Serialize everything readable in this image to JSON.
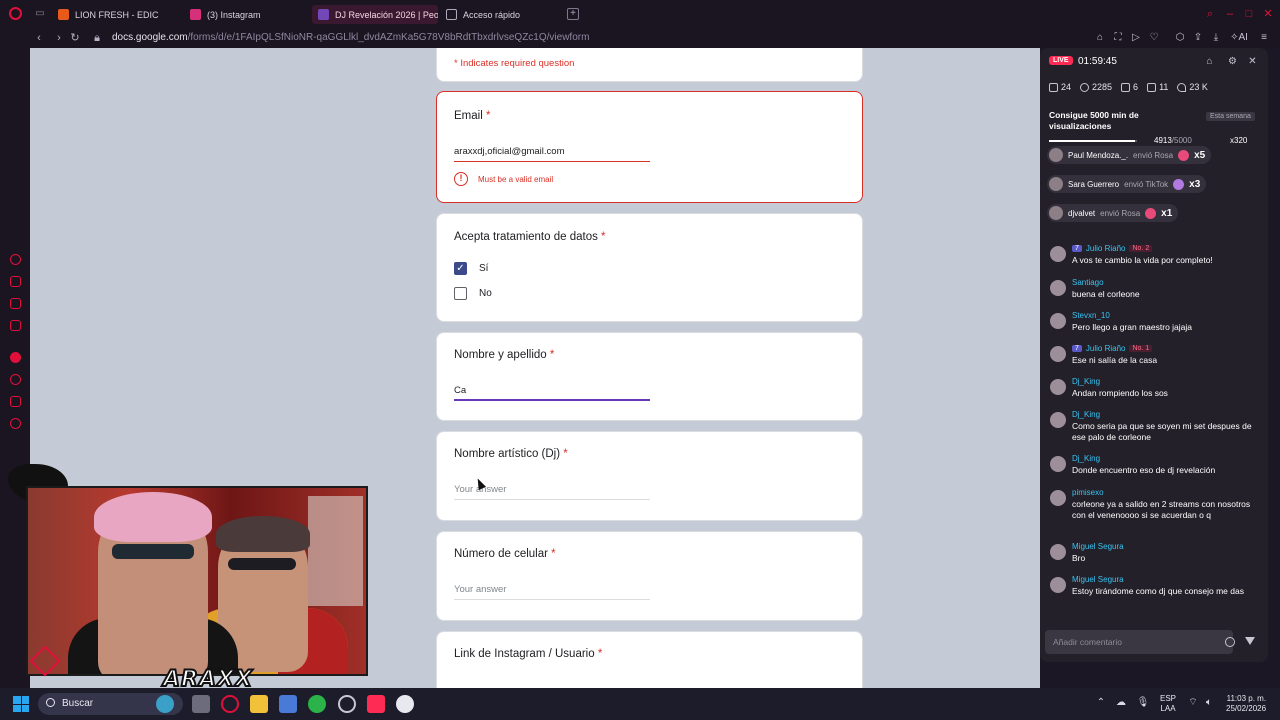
{
  "browser": {
    "tabs": [
      {
        "label": "LION FRESH - EDIC",
        "active": false
      },
      {
        "label": "(3) Instagram",
        "active": false
      },
      {
        "label": "DJ Revelación 2026 | Peo",
        "active": true
      },
      {
        "label": "Acceso rápido",
        "active": false
      }
    ],
    "url_domain": "docs.google.com",
    "url_path": "/forms/d/e/1FAIpQLSfNioNR-qaGGLlkl_dvdAZmKa5G78V8bRdtTbxdrlvseQZc1Q/viewform",
    "toolbar_ai_label": "AI"
  },
  "form": {
    "required_note": "* Indicates required question",
    "req_mark": "*",
    "email": {
      "label": "Email",
      "value": "araxxdj,oficial@gmail.com",
      "error": "Must be a valid email"
    },
    "consent": {
      "label": "Acepta tratamiento de datos",
      "options": [
        {
          "label": "Sí",
          "checked": true
        },
        {
          "label": "No",
          "checked": false
        }
      ]
    },
    "full_name": {
      "label": "Nombre y apellido",
      "value": "Ca"
    },
    "artist_name": {
      "label": "Nombre artístico (Dj)",
      "placeholder": "Your answer"
    },
    "phone": {
      "label": "Número de celular",
      "placeholder": "Your answer"
    },
    "instagram": {
      "label": "Link de Instagram / Usuario"
    }
  },
  "webcam": {
    "logo_text": "ARAXX"
  },
  "live": {
    "badge": "LIVE",
    "time": "01:59:45",
    "stats": {
      "viewers_icon_count": "24",
      "views": "2285",
      "gifts": "6",
      "shares": "11",
      "likes": "23 K"
    },
    "goal": {
      "title": "Consigue 5000 min de visualizaciones",
      "tag": "Esta semana",
      "current": "4913",
      "max": "/5000",
      "progress": 0.9826,
      "reward": "x320"
    },
    "gifts": [
      {
        "user": "Paul Mendoza._.",
        "action": "envió Rosa",
        "count": "x5",
        "color": "#e84a7a"
      },
      {
        "user": "Sara Guerrero",
        "action": "envió TikTok",
        "count": "x3",
        "color": "#b07ae0"
      },
      {
        "user": "djvalvet",
        "action": "envió Rosa",
        "count": "x1",
        "color": "#e84a7a"
      }
    ],
    "messages": [
      {
        "user": "Julio Riaño",
        "level": "7",
        "rank": "No. 2",
        "text": "A vos te cambio la vida por completo!"
      },
      {
        "user": "Santiago",
        "level": "",
        "rank": "",
        "text": "buena el corleone"
      },
      {
        "user": "Stevxn_10",
        "level": "",
        "rank": "",
        "text": "Pero llego a gran maestro jajaja"
      },
      {
        "user": "Julio Riaño",
        "level": "7",
        "rank": "No. 1",
        "text": "Ese ni salía de la casa"
      },
      {
        "user": "Dj_King",
        "level": "",
        "rank": "",
        "text": "Andan rompiendo los sos"
      },
      {
        "user": "Dj_King",
        "level": "",
        "rank": "",
        "text": "Como seria pa que se soyen mi set despues de ese palo de corleone"
      },
      {
        "user": "Dj_King",
        "level": "",
        "rank": "",
        "text": "Donde encuentro eso de dj revelación"
      },
      {
        "user": "pimisexo",
        "level": "",
        "rank": "",
        "text": "corleone ya a salido en 2 streams con nosotros con el venenoooo si se acuerdan o q"
      },
      {
        "user": "Miguel Segura",
        "level": "",
        "rank": "",
        "text": "Bro"
      },
      {
        "user": "Miguel Segura",
        "level": "",
        "rank": "",
        "text": "Estoy tirándome como dj que consejo me das"
      }
    ],
    "comment_placeholder": "Añadir comentario"
  },
  "taskbar": {
    "search_label": "Buscar",
    "lang_top": "ESP",
    "lang_bottom": "LAA",
    "time": "11:03 p. m.",
    "date": "25/02/2026"
  },
  "colors": {
    "accent": "#e0103a",
    "form_error": "#d93025",
    "form_focus": "#673ab7",
    "tiktok_pink": "#fe2c55",
    "username_blue": "#38c3f0"
  }
}
